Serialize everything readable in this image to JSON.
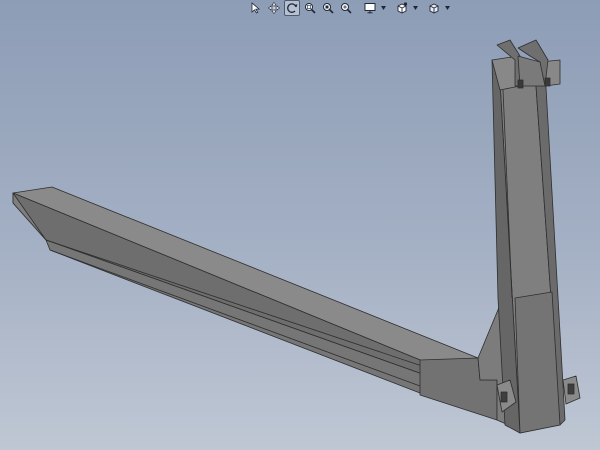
{
  "toolbar": {
    "items": [
      {
        "name": "select-arrow-icon",
        "type": "button",
        "active": false
      },
      {
        "name": "pan-icon",
        "type": "button",
        "active": false
      },
      {
        "name": "rotate-view-icon",
        "type": "button",
        "active": true
      },
      {
        "name": "zoom-to-fit-icon",
        "type": "button",
        "active": false
      },
      {
        "name": "zoom-to-area-icon",
        "type": "button",
        "active": false
      },
      {
        "name": "zoom-in-out-icon",
        "type": "button",
        "active": false
      },
      {
        "name": "display-style-icon",
        "type": "button-dropdown",
        "active": false
      },
      {
        "name": "view-orientation-icon",
        "type": "button-dropdown",
        "active": false
      },
      {
        "name": "hide-show-items-icon",
        "type": "button-dropdown",
        "active": false
      }
    ]
  },
  "model": {
    "name": "fork-arm",
    "face_colors": {
      "light": "#8a8a8a",
      "mid": "#7a7a7a",
      "dark": "#696969",
      "darker": "#5c5c5c",
      "edge": "#2e2e2e"
    }
  }
}
